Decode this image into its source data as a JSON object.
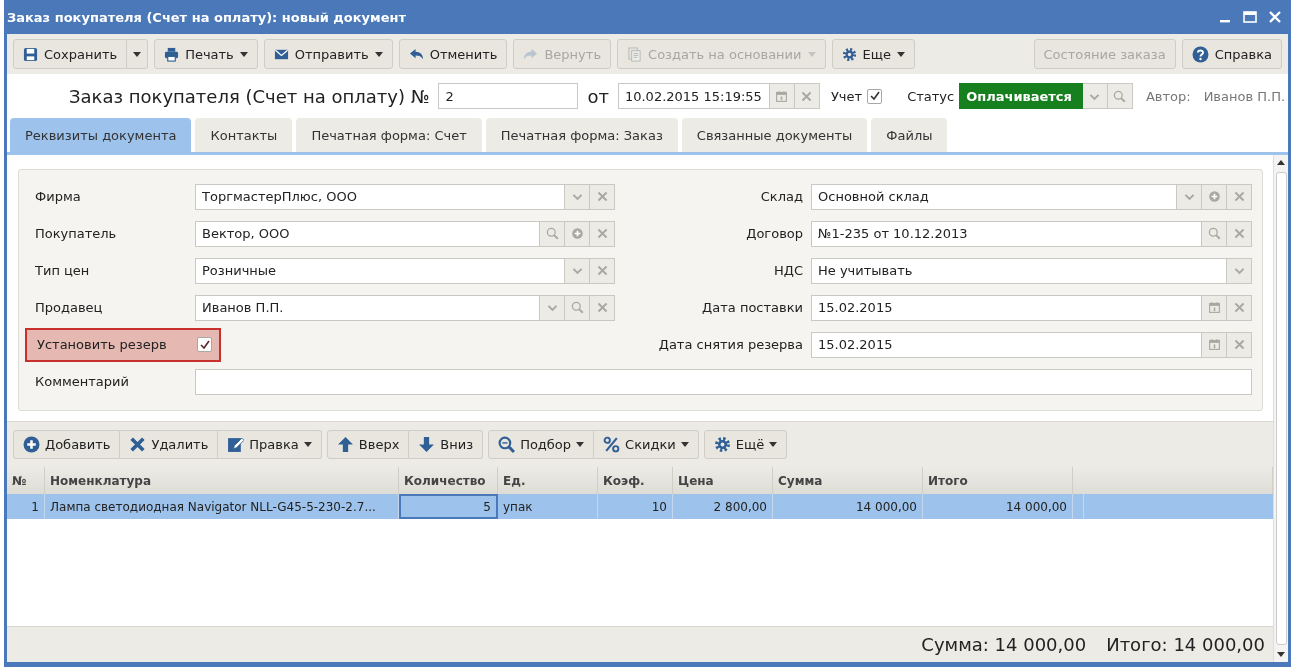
{
  "window": {
    "title": "Заказ покупателя (Счет на оплату): новый документ"
  },
  "toolbar": {
    "buttons": [
      {
        "label": "Сохранить",
        "dropdown": true,
        "split": true,
        "disabled": false
      },
      {
        "label": "Печать",
        "dropdown": true,
        "split": false,
        "disabled": false
      },
      {
        "label": "Отправить",
        "dropdown": true,
        "split": false,
        "disabled": false
      },
      {
        "label": "Отменить",
        "dropdown": false,
        "split": false,
        "disabled": false
      },
      {
        "label": "Вернуть",
        "dropdown": false,
        "split": false,
        "disabled": true
      },
      {
        "label": "Создать на основании",
        "dropdown": true,
        "split": false,
        "disabled": true
      },
      {
        "label": "Еще",
        "dropdown": true,
        "split": false,
        "disabled": false
      }
    ],
    "right_buttons": [
      {
        "label": "Состояние заказа",
        "disabled": true
      },
      {
        "label": "Справка",
        "disabled": false
      }
    ]
  },
  "header": {
    "title": "Заказ покупателя (Счет на оплату) №",
    "number": "2",
    "date_label": "от",
    "date": "10.02.2015 15:19:55",
    "accounting": {
      "label": "Учет",
      "checked": true
    },
    "status": {
      "label": "Статус",
      "value": "Оплачивается"
    },
    "author": {
      "label": "Автор:",
      "value": "Иванов П.П."
    }
  },
  "tabs": [
    {
      "label": "Реквизиты документа",
      "selected": true
    },
    {
      "label": "Контакты",
      "selected": false
    },
    {
      "label": "Печатная форма: Счет",
      "selected": false
    },
    {
      "label": "Печатная форма: Заказ",
      "selected": false
    },
    {
      "label": "Связанные документы",
      "selected": false
    },
    {
      "label": "Файлы",
      "selected": false
    }
  ],
  "form": {
    "left": [
      {
        "kind": "field",
        "label": "Фирма",
        "value": "ТоргмастерПлюс, ООО",
        "actions": [
          {
            "kind": "dropdown"
          },
          {
            "kind": "clear"
          }
        ]
      },
      {
        "kind": "field",
        "label": "Покупатель",
        "value": "Вектор, ООО",
        "actions": [
          {
            "kind": "search"
          },
          {
            "kind": "add"
          },
          {
            "kind": "clear"
          }
        ]
      },
      {
        "kind": "field",
        "label": "Тип цен",
        "value": "Розничные",
        "actions": [
          {
            "kind": "dropdown"
          },
          {
            "kind": "clear"
          }
        ]
      },
      {
        "kind": "field",
        "label": "Продавец",
        "value": "Иванов П.П.",
        "actions": [
          {
            "kind": "dropdown"
          },
          {
            "kind": "search"
          },
          {
            "kind": "clear"
          }
        ]
      },
      {
        "kind": "checkbox",
        "label": "Установить резерв",
        "checked": true,
        "highlighted": true
      }
    ],
    "right": [
      {
        "kind": "field",
        "label": "Склад",
        "value": "Основной склад",
        "actions": [
          {
            "kind": "dropdown"
          },
          {
            "kind": "add"
          },
          {
            "kind": "clear"
          }
        ]
      },
      {
        "kind": "field",
        "label": "Договор",
        "value": "№1-235 от 10.12.2013",
        "actions": [
          {
            "kind": "search"
          },
          {
            "kind": "clear"
          }
        ]
      },
      {
        "kind": "field",
        "label": "НДС",
        "value": "Не учитывать",
        "actions": [
          {
            "kind": "dropdown"
          }
        ]
      },
      {
        "kind": "field",
        "label": "Дата поставки",
        "value": "15.02.2015",
        "actions": [
          {
            "kind": "calendar"
          },
          {
            "kind": "clear"
          }
        ]
      },
      {
        "kind": "field",
        "label": "Дата снятия резерва",
        "value": "15.02.2015",
        "actions": [
          {
            "kind": "calendar"
          },
          {
            "kind": "clear"
          }
        ]
      }
    ],
    "comment": {
      "label": "Комментарий"
    }
  },
  "table_toolbar": {
    "groups": [
      [
        {
          "label": "Добавить",
          "dropdown": false
        },
        {
          "label": "Удалить",
          "dropdown": false
        },
        {
          "label": "Правка",
          "dropdown": true
        }
      ],
      [
        {
          "label": "Вверх",
          "dropdown": false
        },
        {
          "label": "Вниз",
          "dropdown": false
        }
      ],
      [
        {
          "label": "Подбор",
          "dropdown": true
        },
        {
          "label": "Скидки",
          "dropdown": true
        }
      ],
      [
        {
          "label": "Ещё",
          "dropdown": true
        }
      ]
    ]
  },
  "table": {
    "columns": [
      "№",
      "Номенклатура",
      "Количество",
      "Ед.",
      "Коэф.",
      "Цена",
      "Сумма",
      "Итого"
    ],
    "rows": [
      {
        "selected": true,
        "cells": [
          {
            "text": "1",
            "focused": false
          },
          {
            "text": "Лампа светодиодная Navigator NLL-G45-5-230-2.7...",
            "focused": false
          },
          {
            "text": "5",
            "focused": true
          },
          {
            "text": "упак",
            "focused": false
          },
          {
            "text": "10",
            "focused": false
          },
          {
            "text": "2 800,00",
            "focused": false
          },
          {
            "text": "14 000,00",
            "focused": false
          },
          {
            "text": "14 000,00",
            "focused": false
          }
        ]
      }
    ]
  },
  "totals": [
    {
      "text": "Сумма: 14 000,00"
    },
    {
      "text": "Итого: 14 000,00"
    }
  ]
}
